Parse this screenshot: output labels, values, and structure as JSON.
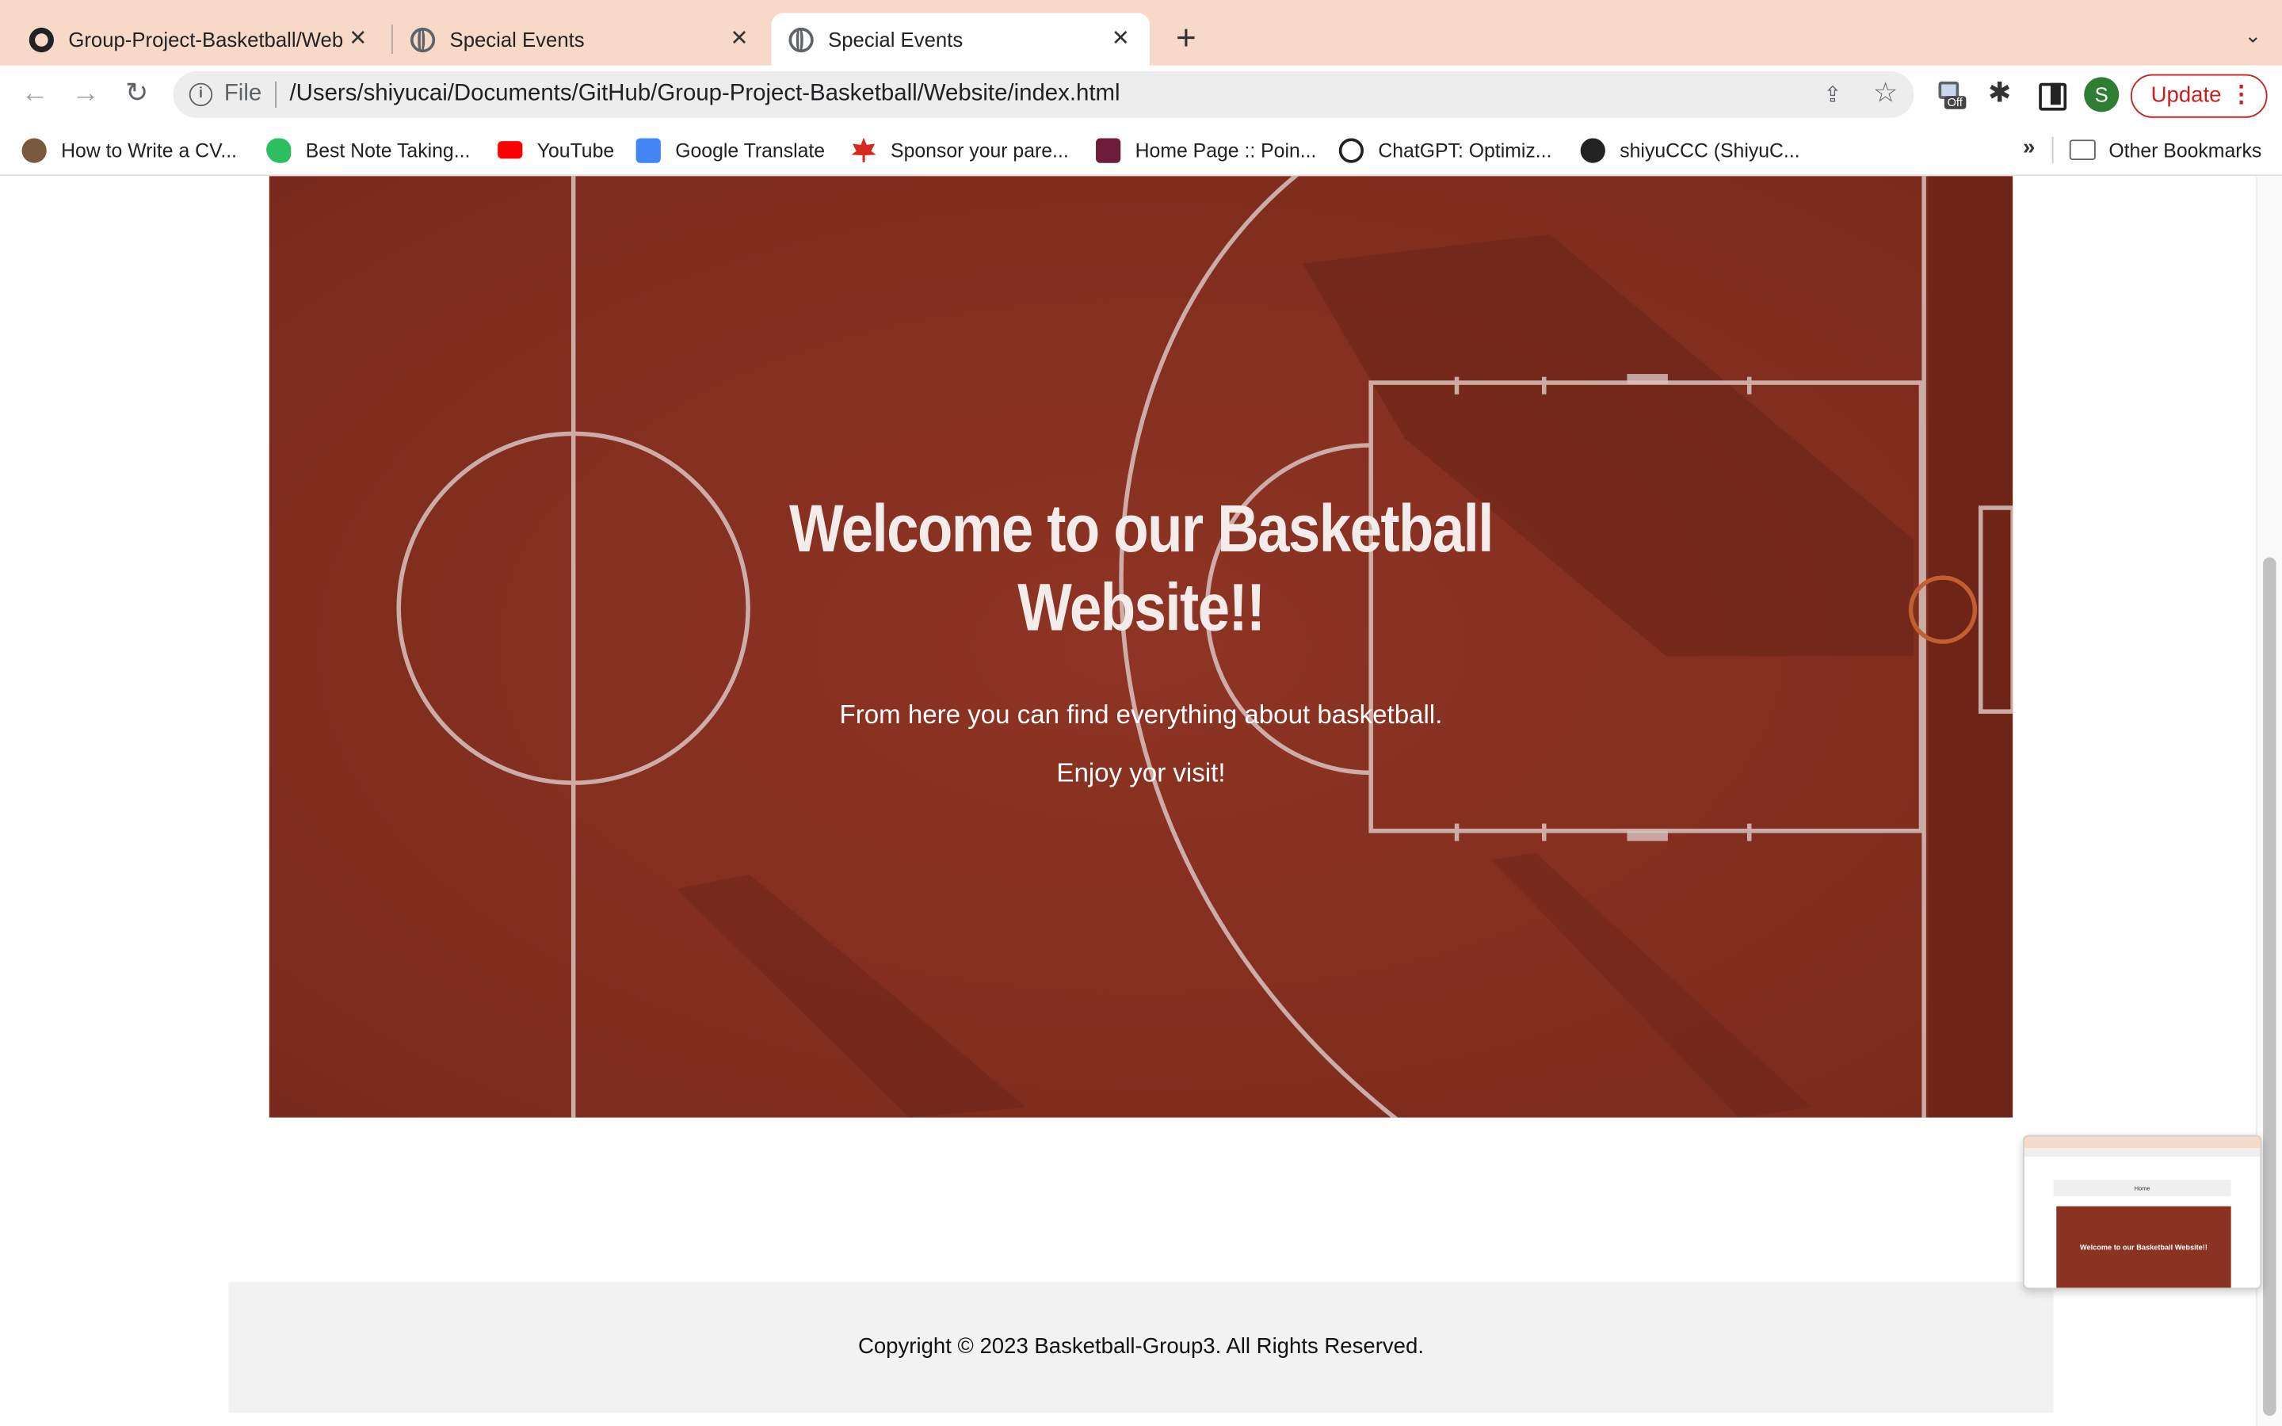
{
  "tabs": [
    {
      "title": "Group-Project-Basketball/Web",
      "icon": "github-icon",
      "active": false
    },
    {
      "title": "Special Events",
      "icon": "globe-icon",
      "active": false
    },
    {
      "title": "Special Events",
      "icon": "globe-icon",
      "active": true
    }
  ],
  "toolbar": {
    "scheme_label": "File",
    "url": "/Users/shiyucai/Documents/GitHub/Group-Project-Basketball/Website/index.html",
    "extension_badge": "Off",
    "avatar_letter": "S",
    "update_label": "Update"
  },
  "bookmarks": [
    {
      "label": "How to Write a CV...",
      "icon": "cv-site-icon",
      "color": "#7a5a3c"
    },
    {
      "label": "Best Note Taking...",
      "icon": "evernote-icon",
      "color": "#2dbe60"
    },
    {
      "label": "YouTube",
      "icon": "youtube-icon",
      "color": "#ff0000"
    },
    {
      "label": "Google Translate",
      "icon": "google-translate-icon",
      "color": "#4285f4"
    },
    {
      "label": "Sponsor your pare...",
      "icon": "maple-leaf-icon",
      "color": "#d52b1e"
    },
    {
      "label": "Home Page :: Poin...",
      "icon": "star-badge-icon",
      "color": "#6b1d3a"
    },
    {
      "label": "ChatGPT: Optimiz...",
      "icon": "openai-icon",
      "color": "#222222"
    },
    {
      "label": "shiyuCCC (ShiyuC...",
      "icon": "github-icon",
      "color": "#222222"
    }
  ],
  "other_bookmarks": "Other Bookmarks",
  "hero": {
    "title_line1": "Welcome to our Basketball",
    "title_line2": "Website!!",
    "subtitle": "From here you can find everything about basketball.",
    "tagline": "Enjoy yor visit!"
  },
  "thumbnail": {
    "nav_label": "Home",
    "hero_text": "Welcome to our Basketball Website!!"
  },
  "footer": {
    "copyright": "Copyright © 2023 Basketball-Group3. All Rights Reserved."
  },
  "colors": {
    "tab_strip": "#f7d9c9",
    "court": "#8b3322",
    "update_accent": "#c5221f",
    "footer_bg": "#f2f2f2"
  }
}
